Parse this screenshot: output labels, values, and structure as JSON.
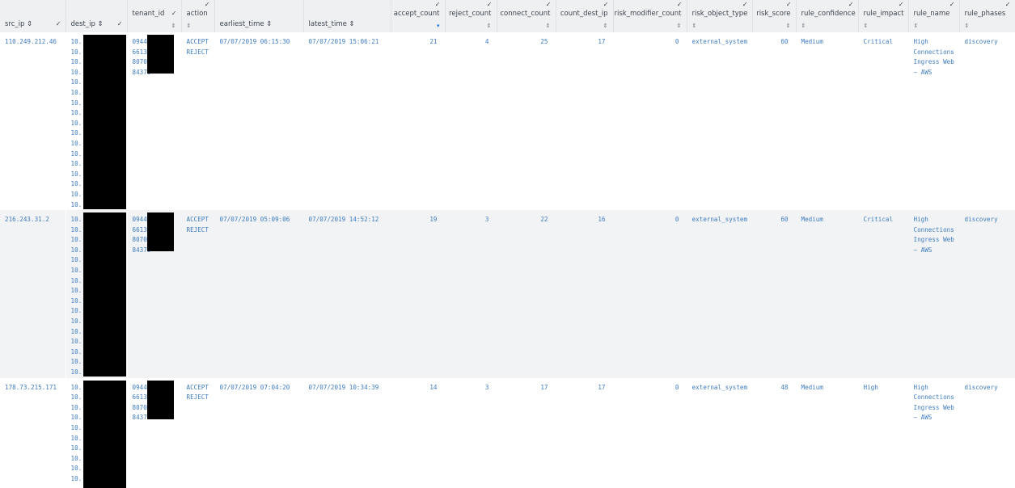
{
  "columns": [
    {
      "key": "src_ip",
      "label": "src_ip ⇕"
    },
    {
      "key": "dest_ip",
      "label": "dest_ip ⇕"
    },
    {
      "key": "tenant_id",
      "label": "tenant_id"
    },
    {
      "key": "action",
      "label": "action"
    },
    {
      "key": "earliest_time",
      "label": "earliest_time ⇕"
    },
    {
      "key": "latest_time",
      "label": "latest_time ⇕"
    },
    {
      "key": "accept_count",
      "label": "accept_count"
    },
    {
      "key": "reject_count",
      "label": "reject_count"
    },
    {
      "key": "connect_count",
      "label": "connect_count"
    },
    {
      "key": "count_dest_ip",
      "label": "count_dest_ip"
    },
    {
      "key": "risk_modifier_count",
      "label": "risk_modifier_count"
    },
    {
      "key": "risk_object_type",
      "label": "risk_object_type"
    },
    {
      "key": "risk_score",
      "label": "risk_score"
    },
    {
      "key": "rule_confidence",
      "label": "rule_confidence"
    },
    {
      "key": "rule_impact",
      "label": "rule_impact"
    },
    {
      "key": "rule_name",
      "label": "rule_name"
    },
    {
      "key": "rule_phases",
      "label": "rule_phases"
    }
  ],
  "sort_icon": "⇕",
  "sort_active_icon": "▾",
  "edit_icon": "✓",
  "rows": [
    {
      "src_ip": "110.249.212.46",
      "dest_ip": [
        "10.",
        "10.",
        "10.",
        "10.",
        "10.",
        "10.",
        "10.",
        "10.",
        "10.",
        "10.",
        "10.",
        "10.",
        "10.",
        "10.",
        "10.",
        "10.",
        "10."
      ],
      "tenant_id": [
        "09448",
        "66131",
        "80703",
        "84370"
      ],
      "action": [
        "ACCEPT",
        "REJECT"
      ],
      "earliest_time": "07/07/2019 06:15:30",
      "latest_time": "07/07/2019 15:06:21",
      "accept_count": "21",
      "reject_count": "4",
      "connect_count": "25",
      "count_dest_ip": "17",
      "risk_modifier_count": "0",
      "risk_object_type": "external_system",
      "risk_score": "60",
      "rule_confidence": "Medium",
      "rule_impact": "Critical",
      "rule_name": [
        "High",
        "Connections",
        "Ingress Web",
        "– AWS"
      ],
      "rule_phases": "discovery"
    },
    {
      "src_ip": "216.243.31.2",
      "dest_ip": [
        "10.",
        "10.",
        "10.",
        "10.",
        "10.",
        "10.",
        "10.",
        "10.",
        "10.",
        "10.",
        "10.",
        "10.",
        "10.",
        "10.",
        "10.",
        "10."
      ],
      "tenant_id": [
        "09448",
        "66131",
        "80703",
        "84370"
      ],
      "action": [
        "ACCEPT",
        "REJECT"
      ],
      "earliest_time": "07/07/2019 05:09:06",
      "latest_time": "07/07/2019 14:52:12",
      "accept_count": "19",
      "reject_count": "3",
      "connect_count": "22",
      "count_dest_ip": "16",
      "risk_modifier_count": "0",
      "risk_object_type": "external_system",
      "risk_score": "60",
      "rule_confidence": "Medium",
      "rule_impact": "Critical",
      "rule_name": [
        "High",
        "Connections",
        "Ingress Web",
        "– AWS"
      ],
      "rule_phases": "discovery"
    },
    {
      "src_ip": "178.73.215.171",
      "dest_ip": [
        "10.",
        "10.",
        "10.",
        "10.",
        "10.",
        "10.",
        "10.",
        "10.",
        "10.",
        "10."
      ],
      "tenant_id": [
        "09448",
        "66131",
        "80703",
        "84370"
      ],
      "action": [
        "ACCEPT",
        "REJECT"
      ],
      "earliest_time": "07/07/2019 07:04:20",
      "latest_time": "07/07/2019 10:34:39",
      "accept_count": "14",
      "reject_count": "3",
      "connect_count": "17",
      "count_dest_ip": "17",
      "risk_modifier_count": "0",
      "risk_object_type": "external_system",
      "risk_score": "48",
      "rule_confidence": "Medium",
      "rule_impact": "High",
      "rule_name": [
        "High",
        "Connections",
        "Ingress Web",
        "– AWS"
      ],
      "rule_phases": "discovery"
    }
  ]
}
